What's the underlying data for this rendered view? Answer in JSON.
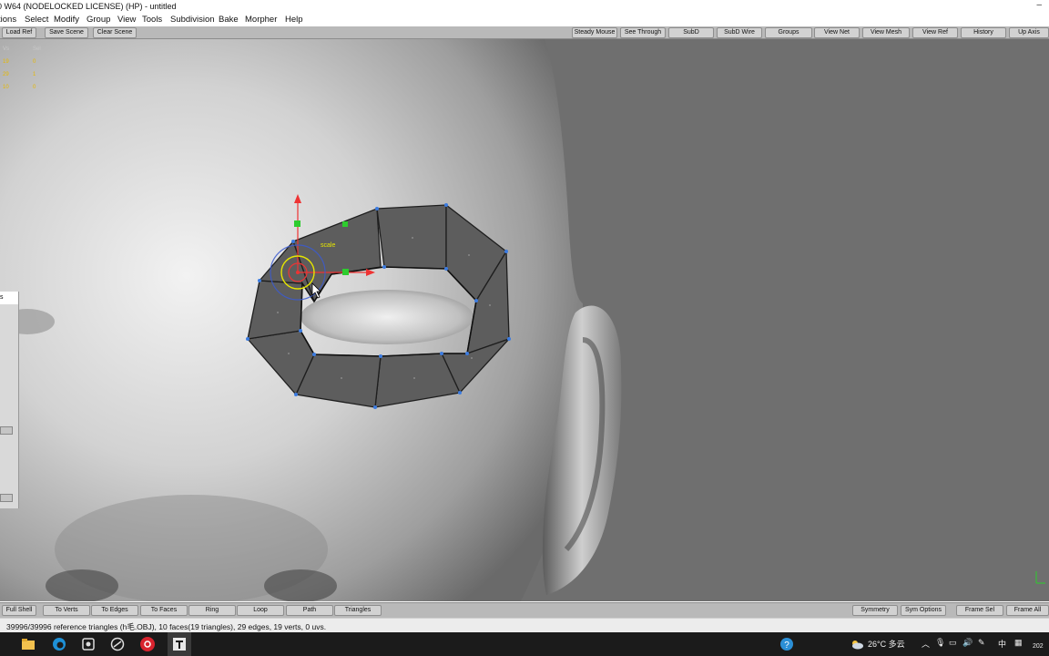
{
  "window": {
    "title": "0 W64  (NODELOCKED LICENSE) (HP) - untitled",
    "minimize_glyph": "–"
  },
  "menu": [
    "tions",
    "Select",
    "Modify",
    "Group",
    "View",
    "Tools",
    "Subdivision",
    "Bake",
    "Morpher",
    "Help"
  ],
  "toolbar": {
    "left": [
      "Load Ref",
      "Save Scene",
      "Clear Scene"
    ],
    "right": [
      "Steady Mouse",
      "See Through",
      "SubD",
      "SubD Wire",
      "Groups",
      "View Net",
      "View Mesh",
      "View Ref",
      "History",
      "Up Axis"
    ]
  },
  "stats": {
    "headers": [
      "Vs",
      "Sel"
    ],
    "rows": [
      [
        "19",
        "0"
      ],
      [
        "29",
        "1"
      ],
      [
        "10",
        "0"
      ]
    ]
  },
  "viewport": {
    "gizmo_label": "scale",
    "colors": {
      "background": "#6f6f6f",
      "mesh_face": "#5e5e5e",
      "vertex": "#3b7be0",
      "accent_yellow": "#e6e600"
    }
  },
  "side_panel": {
    "tab_label": "s"
  },
  "bottom_toolbar": {
    "left": [
      "Full Shell",
      "To Verts",
      "To Edges",
      "To Faces",
      "Ring",
      "Loop",
      "Path",
      "Triangles"
    ],
    "right": [
      "Symmetry",
      "Sym Options",
      "Frame Sel",
      "Frame All"
    ]
  },
  "status": {
    "text": "39996/39996 reference triangles (h毛.OBJ), 10 faces(19 triangles), 29 edges, 19 verts, 0 uvs."
  },
  "taskbar": {
    "weather": "26°C 多云",
    "ime": "中",
    "clock_fragment": "202",
    "icons": [
      "explorer-icon",
      "edge-browser-icon",
      "app-icon",
      "app-icon",
      "netease-music-icon",
      "topogun-icon"
    ]
  }
}
